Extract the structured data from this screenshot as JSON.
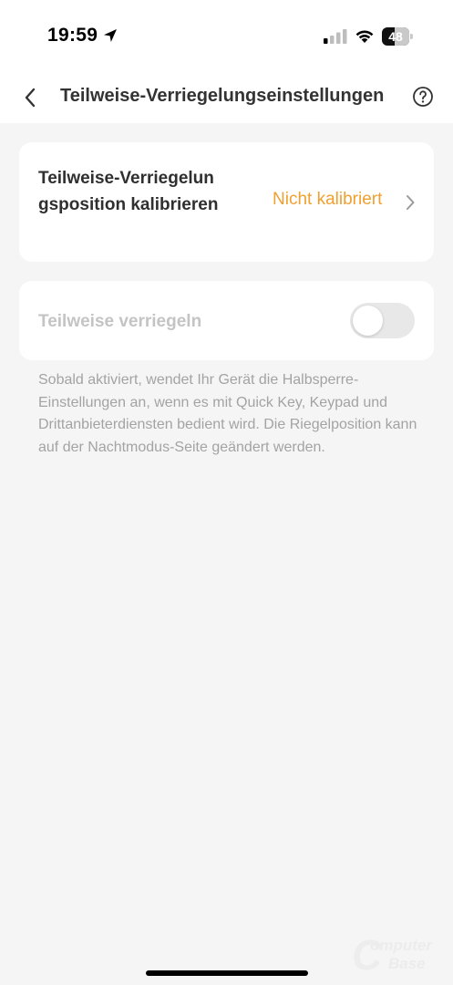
{
  "status_bar": {
    "time": "19:59",
    "battery_level": "48",
    "battery_fraction": 0.48,
    "icons": [
      "location-arrow-icon",
      "cellular-signal-icon",
      "wifi-icon",
      "battery-icon"
    ]
  },
  "nav": {
    "title": "Teilweise-Verriegelungseinstellungen",
    "back_icon": "chevron-left-icon",
    "help_icon": "question-circle-icon"
  },
  "calibration": {
    "label": "Teilweise-Verriegelungsposition kalibrieren",
    "status": "Nicht kalibriert",
    "status_color": "#f0a030",
    "chevron_icon": "chevron-right-icon"
  },
  "partial_lock": {
    "label": "Teilweise verriegeln",
    "enabled": false,
    "disabled_text_color": "#c4c4c4"
  },
  "description": "Sobald aktiviert, wendet Ihr Gerät die Halbsperre-Einstellungen an, wenn es mit Quick Key, Keypad und Drittanbieterdiensten bedient wird. Die Riegelposition kann auf der Nachtmodus-Seite geändert werden.",
  "watermark": {
    "initial": "C",
    "line1": "omputer",
    "line2": "Base"
  }
}
